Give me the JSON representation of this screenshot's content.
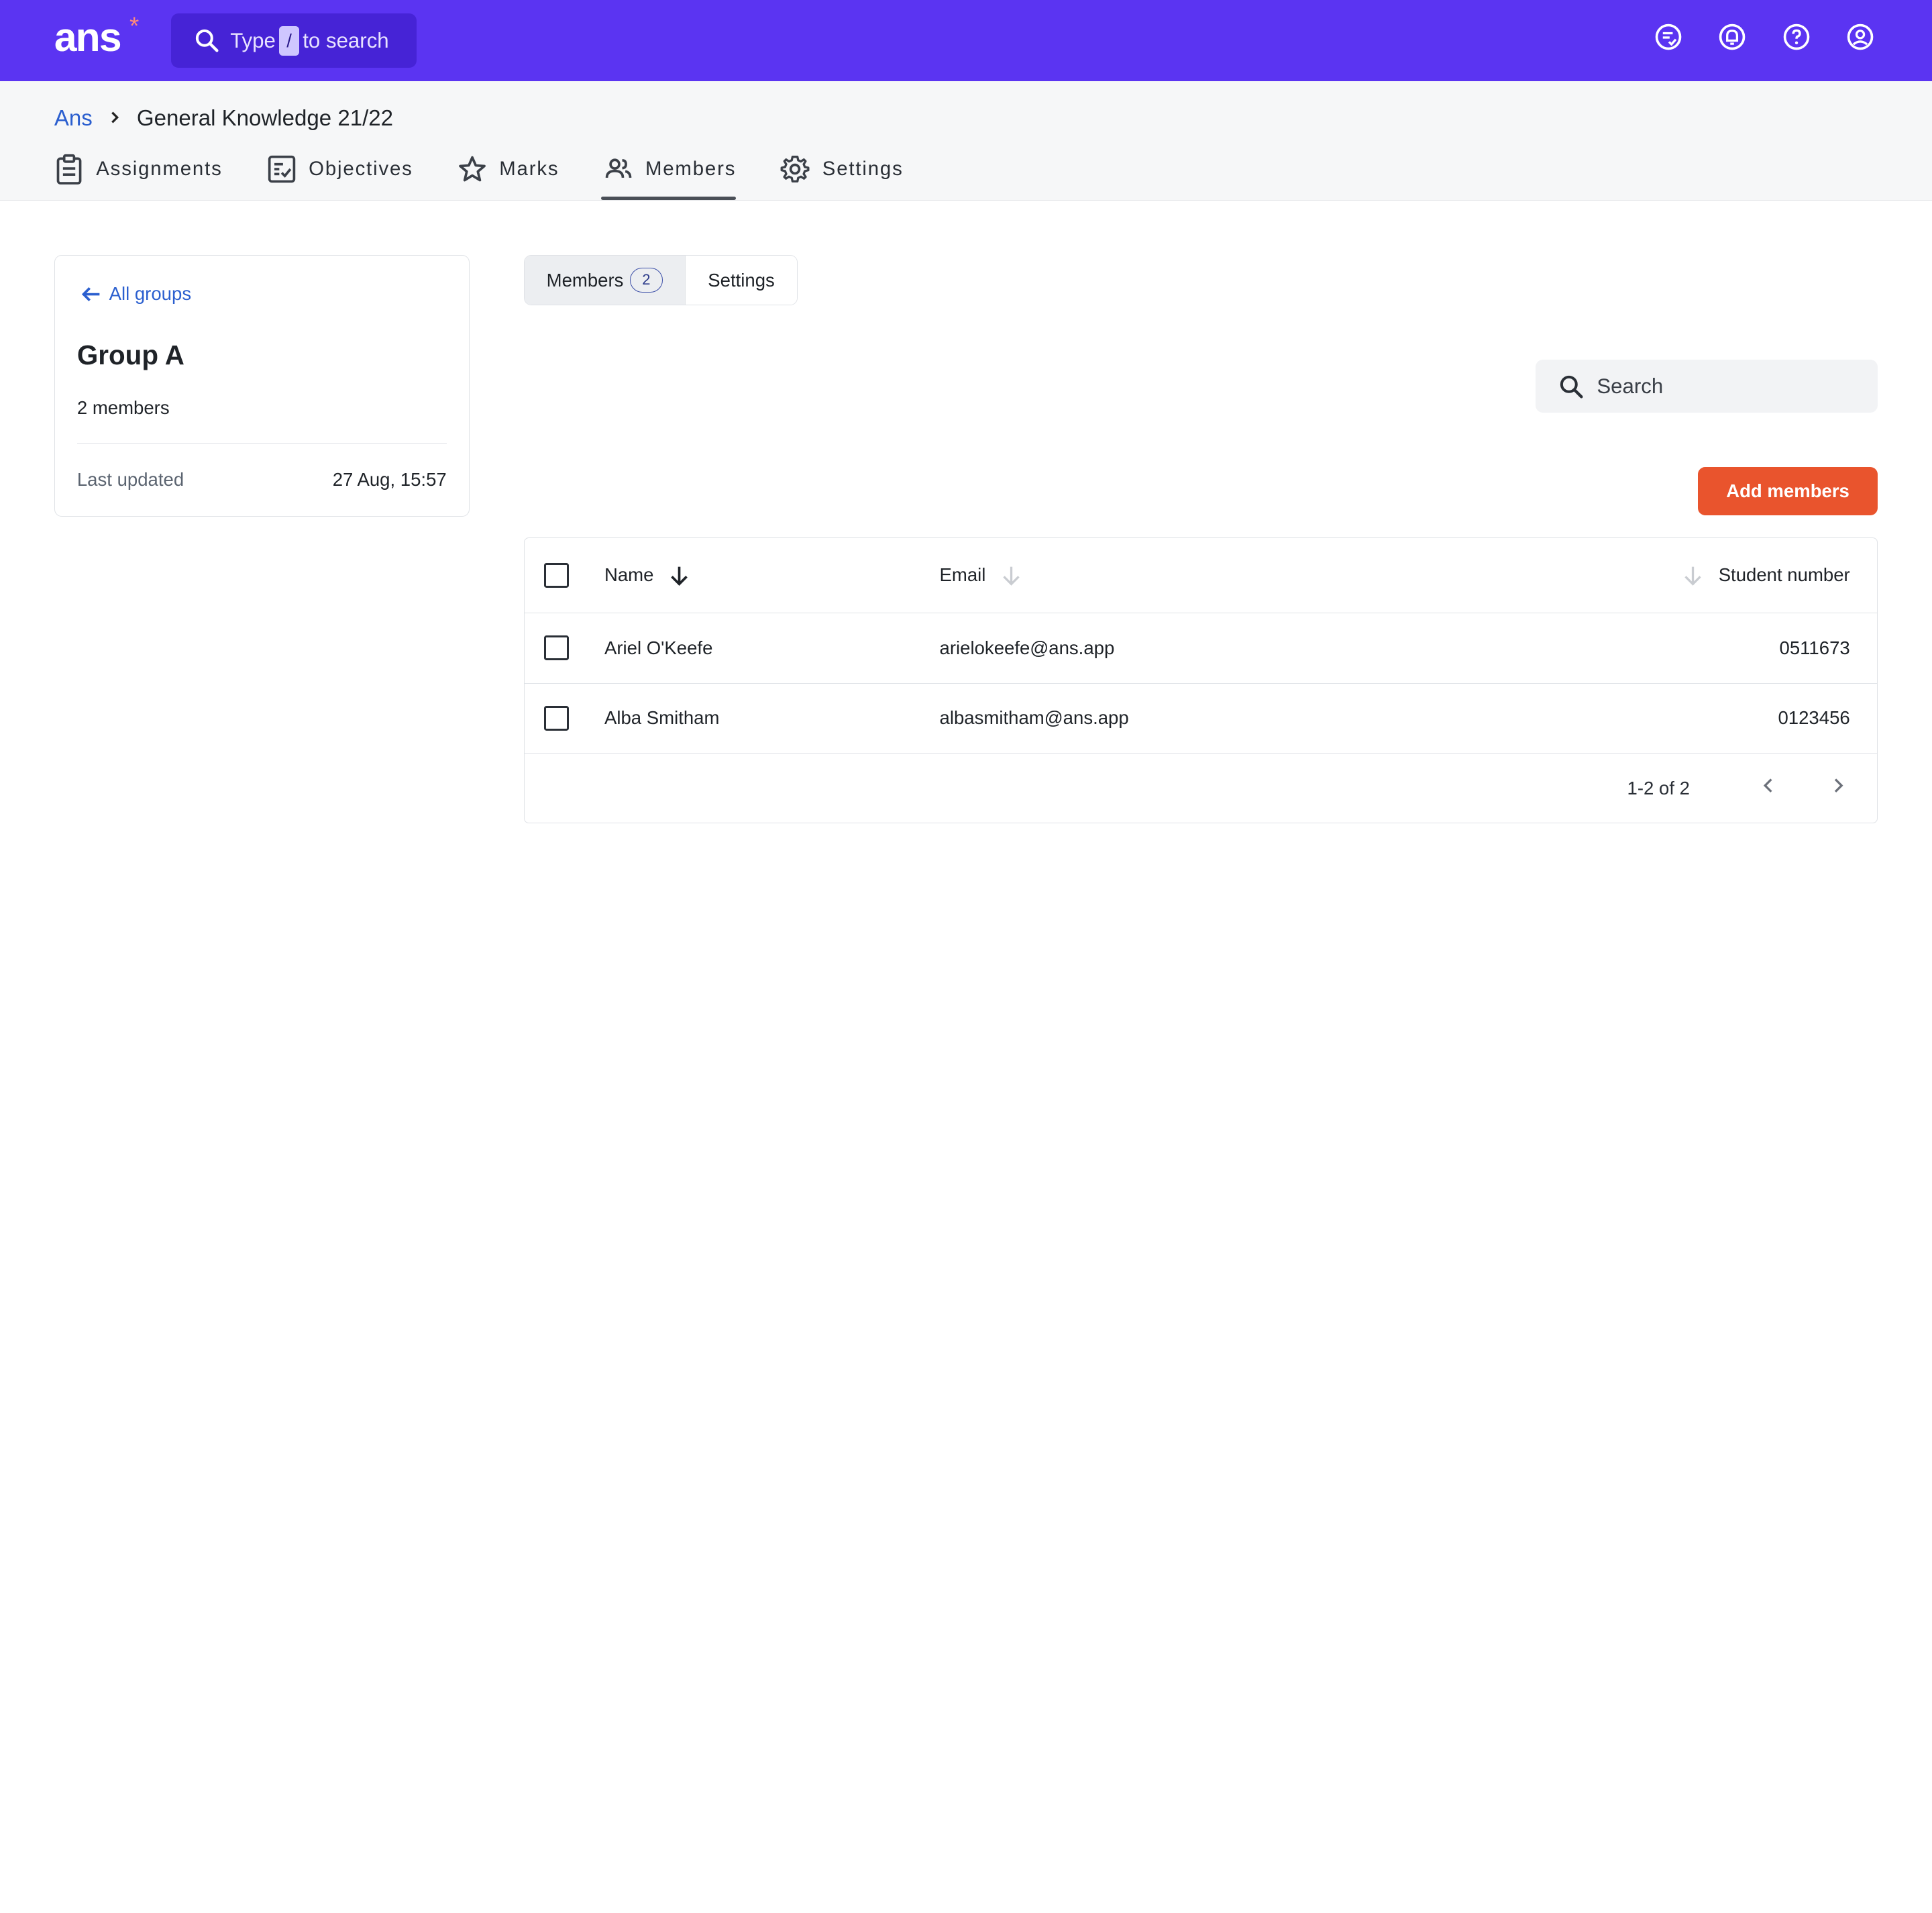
{
  "topbar": {
    "logo": "ans",
    "logo_mark": "*",
    "search_prefix": "Type",
    "search_key": "/",
    "search_suffix": "to search",
    "icons": [
      "feedback-icon",
      "notifications-icon",
      "help-icon",
      "account-icon"
    ]
  },
  "breadcrumb": {
    "root": "Ans",
    "current": "General Knowledge 21/22"
  },
  "tabs": [
    {
      "label": "Assignments",
      "icon": "clipboard-icon"
    },
    {
      "label": "Objectives",
      "icon": "checklist-icon"
    },
    {
      "label": "Marks",
      "icon": "star-icon"
    },
    {
      "label": "Members",
      "icon": "people-icon",
      "active": true
    },
    {
      "label": "Settings",
      "icon": "gear-icon"
    }
  ],
  "group": {
    "back_label": "All groups",
    "name": "Group A",
    "members_text": "2 members",
    "last_updated_label": "Last updated",
    "last_updated_value": "27 Aug, 15:57"
  },
  "segment": {
    "members_label": "Members",
    "members_count": "2",
    "settings_label": "Settings"
  },
  "search": {
    "placeholder": "Search"
  },
  "add_button": "Add members",
  "table": {
    "columns": [
      "Name",
      "Email",
      "Student number"
    ],
    "rows": [
      {
        "name": "Ariel O'Keefe",
        "email": "arielokeefe@ans.app",
        "student_number": "0511673"
      },
      {
        "name": "Alba Smitham",
        "email": "albasmitham@ans.app",
        "student_number": "0123456"
      }
    ],
    "pagination": "1-2 of 2"
  },
  "colors": {
    "brand": "#5b34f2",
    "accent_button": "#e9542d",
    "link": "#2b5fcf"
  }
}
